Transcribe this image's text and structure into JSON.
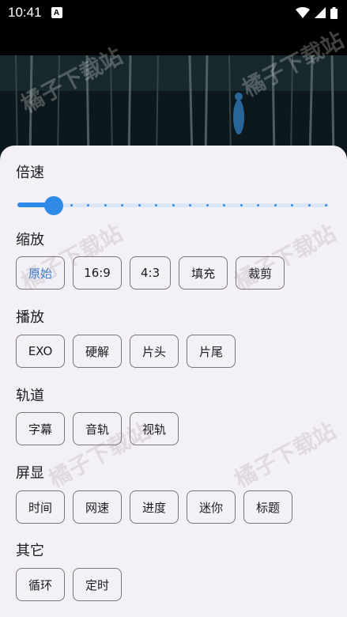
{
  "status_bar": {
    "time": "10:41",
    "notification_glyph": "A",
    "icons": [
      "wifi-icon",
      "signal-icon",
      "battery-icon"
    ]
  },
  "watermark": "橘子下载站",
  "settings": {
    "speed": {
      "title": "倍速",
      "slider_value_fraction": 0.1,
      "tick_count": 16
    },
    "zoom": {
      "title": "缩放",
      "options": [
        "原始",
        "16:9",
        "4:3",
        "填充",
        "裁剪"
      ],
      "selected": "原始"
    },
    "playback": {
      "title": "播放",
      "options": [
        "EXO",
        "硬解",
        "片头",
        "片尾"
      ]
    },
    "track": {
      "title": "轨道",
      "options": [
        "字幕",
        "音轨",
        "视轨"
      ]
    },
    "display": {
      "title": "屏显",
      "options": [
        "时间",
        "网速",
        "进度",
        "迷你",
        "标题"
      ]
    },
    "other": {
      "title": "其它",
      "options": [
        "循环",
        "定时"
      ]
    }
  },
  "colors": {
    "accent": "#2e8ae6",
    "selected_text": "#3a7fd5",
    "sheet_bg": "#f4f0f7",
    "chip_border": "#79747e"
  }
}
